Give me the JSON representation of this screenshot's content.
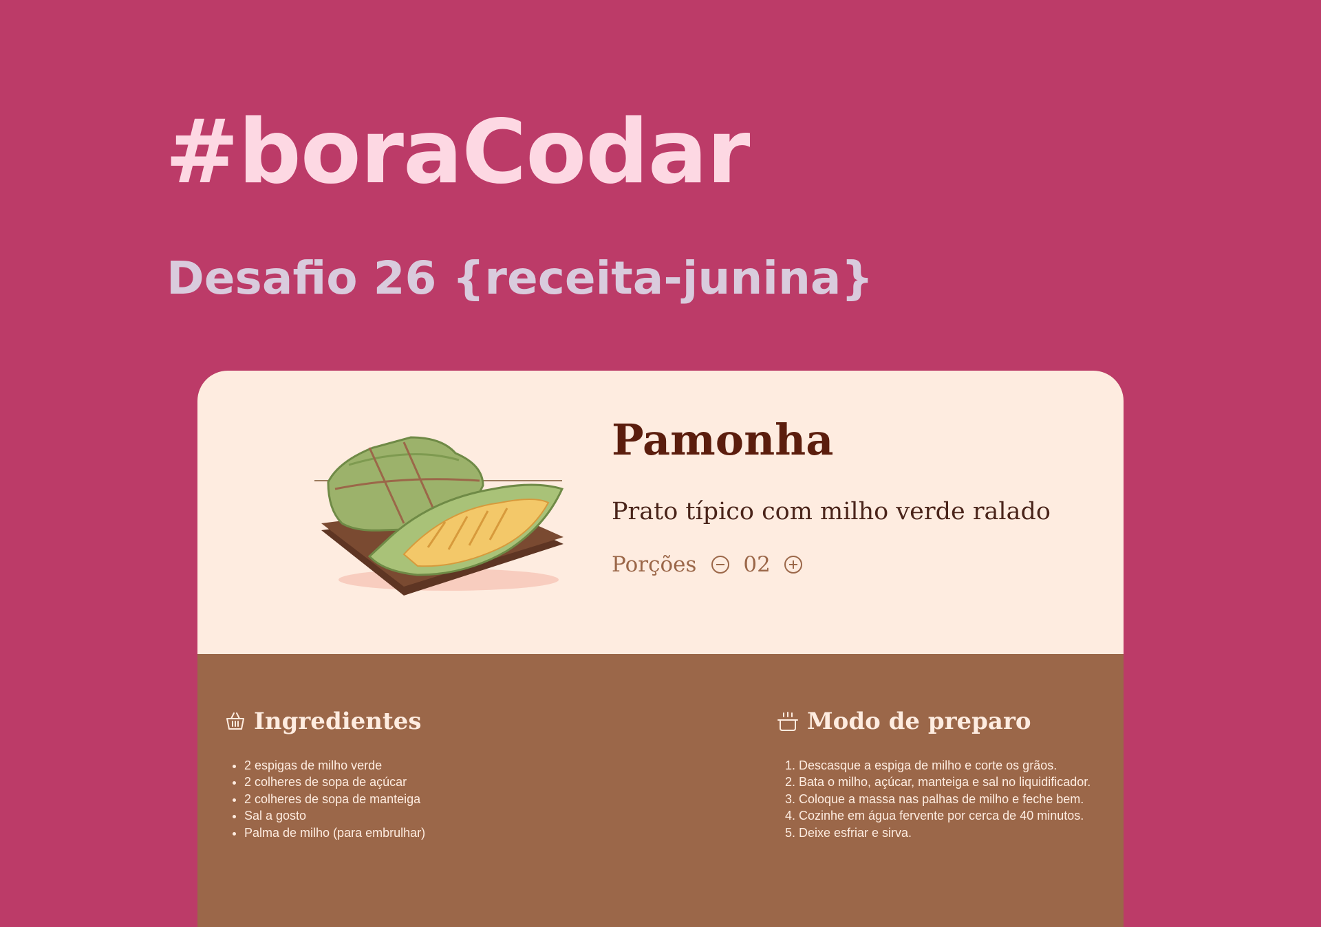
{
  "header": {
    "title": "#boraCodar",
    "subtitle": "Desafio 26 {receita-junina}"
  },
  "recipe": {
    "name": "Pamonha",
    "description": "Prato típico com milho verde ralado",
    "portions": {
      "label": "Porções",
      "value": "02",
      "decrease_icon": "minus-circle-icon",
      "increase_icon": "plus-circle-icon"
    },
    "image": {
      "icon": "pamonha-illustration"
    }
  },
  "ingredients": {
    "title": "Ingredientes",
    "icon": "basket-icon",
    "items": [
      "2 espigas de milho verde",
      "2 colheres de sopa de açúcar",
      "2 colheres de sopa de manteiga",
      "Sal a gosto",
      "Palma de milho (para embrulhar)"
    ]
  },
  "preparation": {
    "title": "Modo de preparo",
    "icon": "cooking-pot-icon",
    "steps": [
      "Descasque a espiga de milho e corte os grãos.",
      "Bata o milho, açúcar, manteiga e sal no liquidificador.",
      "Coloque a massa nas palhas de milho e feche bem.",
      "Cozinhe em água fervente por cerca de 40 minutos.",
      "Deixe esfriar e sirva."
    ]
  },
  "colors": {
    "background": "#bc3b68",
    "title": "#fdd8e3",
    "subtitle": "#d9cbdd",
    "card_top": "#feece0",
    "card_bottom": "#9b6749",
    "recipe_title": "#5b1d0d"
  }
}
